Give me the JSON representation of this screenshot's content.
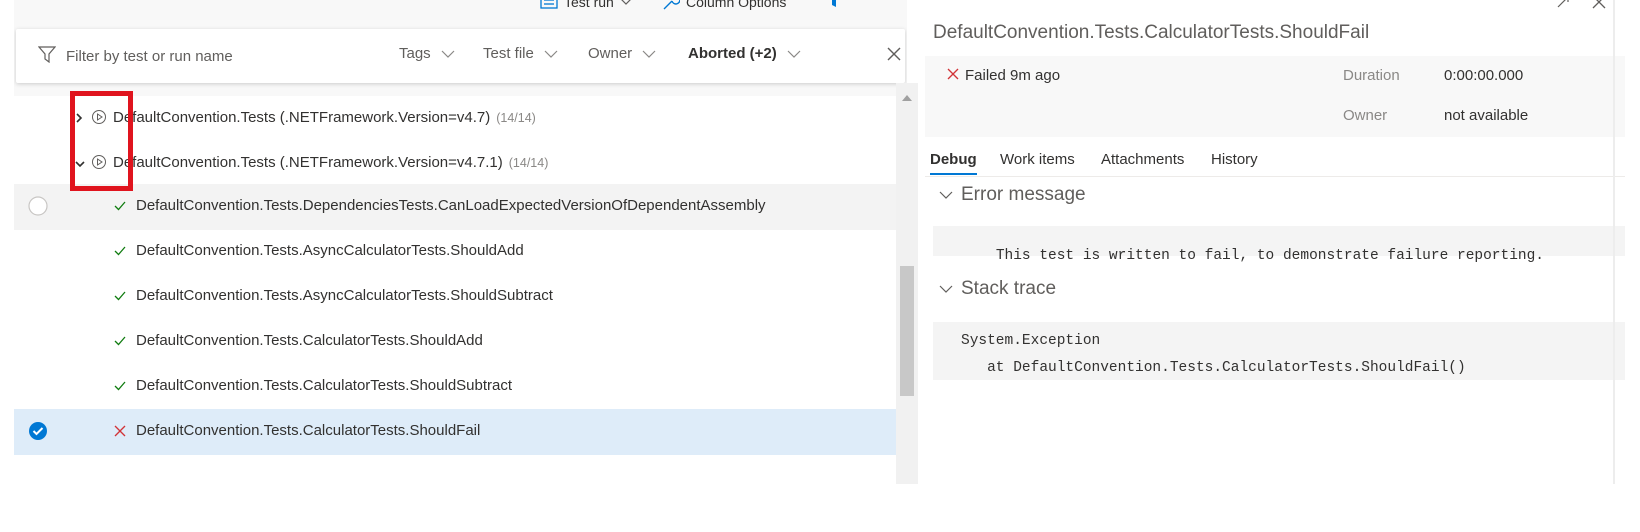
{
  "toolbar": {
    "test_run_label": "Test run",
    "column_options_label": "Column Options"
  },
  "filter": {
    "placeholder": "Filter by test or run name",
    "chips": [
      {
        "label": "Tags"
      },
      {
        "label": "Test file"
      },
      {
        "label": "Owner"
      },
      {
        "label": "Aborted (+2)"
      }
    ]
  },
  "tree": {
    "groups": [
      {
        "name": "DefaultConvention.Tests (.NETFramework.Version=v4.7)",
        "count": "(14/14)",
        "expanded": false
      },
      {
        "name": "DefaultConvention.Tests (.NETFramework.Version=v4.7.1)",
        "count": "(14/14)",
        "expanded": true
      }
    ],
    "tests": [
      {
        "name": "DefaultConvention.Tests.DependenciesTests.CanLoadExpectedVersionOfDependentAssembly",
        "status": "passed"
      },
      {
        "name": "DefaultConvention.Tests.AsyncCalculatorTests.ShouldAdd",
        "status": "passed"
      },
      {
        "name": "DefaultConvention.Tests.AsyncCalculatorTests.ShouldSubtract",
        "status": "passed"
      },
      {
        "name": "DefaultConvention.Tests.CalculatorTests.ShouldAdd",
        "status": "passed"
      },
      {
        "name": "DefaultConvention.Tests.CalculatorTests.ShouldSubtract",
        "status": "passed"
      },
      {
        "name": "DefaultConvention.Tests.CalculatorTests.ShouldFail",
        "status": "failed"
      }
    ]
  },
  "detail": {
    "title": "DefaultConvention.Tests.CalculatorTests.ShouldFail",
    "status_text": "Failed 9m ago",
    "duration_label": "Duration",
    "duration_value": "0:00:00.000",
    "owner_label": "Owner",
    "owner_value": "not available",
    "tabs": [
      {
        "label": "Debug"
      },
      {
        "label": "Work items"
      },
      {
        "label": "Attachments"
      },
      {
        "label": "History"
      }
    ],
    "error_heading": "Error message",
    "error_message": "This test is written to fail, to demonstrate failure reporting.",
    "stack_heading": "Stack trace",
    "stack_line_1": "System.Exception",
    "stack_line_2": "   at DefaultConvention.Tests.CalculatorTests.ShouldFail()"
  },
  "colors": {
    "accent": "#0078d4",
    "pass": "#107c10",
    "fail": "#d13438",
    "highlight": "#e0141e"
  }
}
